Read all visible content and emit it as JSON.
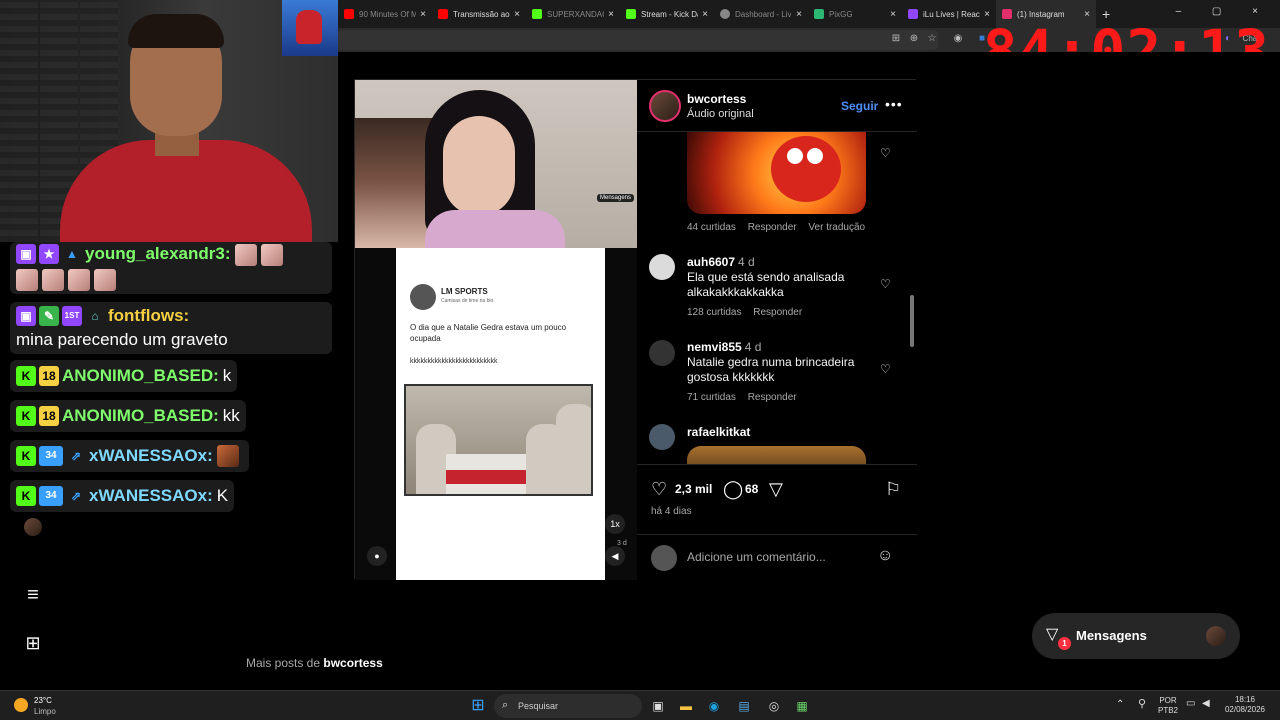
{
  "browser": {
    "tabs": [
      {
        "label": "90 Minutes Of M",
        "icon_color": "#ff0000",
        "active": false
      },
      {
        "label": "Transmissão ao vi",
        "icon_color": "#ff0000",
        "active": false
      },
      {
        "label": "SUPERXANDAO",
        "icon_color": "#53fc18",
        "active": false
      },
      {
        "label": "Stream - Kick Da",
        "icon_color": "#53fc18",
        "active": false
      },
      {
        "label": "Dashboard - Liv",
        "icon_color": "#888888",
        "active": false
      },
      {
        "label": "PixGG",
        "icon_color": "#2bb673",
        "active": false
      },
      {
        "label": "iLu Lives | React",
        "icon_color": "#9146ff",
        "active": false
      },
      {
        "label": "(1) Instagram",
        "icon_color": "#e1306c",
        "active": true
      }
    ],
    "new_tab": "+",
    "chat_label": "Chat"
  },
  "overlay": {
    "timer": "84:02:13"
  },
  "stream_chat": {
    "messages": [
      {
        "user": "young_alexandr3:",
        "text": "",
        "color": "#7fff6b"
      },
      {
        "user": "fontflows:",
        "text": "mina parecendo um graveto",
        "color": "#f5d042"
      },
      {
        "user": "ANONIMO_BASED:",
        "text": "k",
        "color": "#7fff6b",
        "badge": "18"
      },
      {
        "user": "ANONIMO_BASED:",
        "text": "kk",
        "color": "#7fff6b",
        "badge": "18"
      },
      {
        "user": "xWANESSAOx:",
        "text": "",
        "color": "#7fd8ff",
        "badge": "34"
      },
      {
        "user": "xWANESSAOx:",
        "text": "K",
        "color": "#7fd8ff",
        "badge": "34"
      }
    ],
    "subscriber_badge": "1ST"
  },
  "video": {
    "lm_name": "LM SPORTS",
    "lm_sub": "Camisas de time na bio.",
    "lm_text": "O dia que a Natalie Gedra estava um pouco ocupada",
    "lm_kk": "kkkkkkkkkkkkkkkkkkkkkkkkk",
    "speed": "1x",
    "mensagens_tag": "Mensagens",
    "time_tag": "3 d"
  },
  "post": {
    "username": "bwcortess",
    "audio": "Áudio original",
    "follow_label": "Seguir",
    "more_label": "•••",
    "likes": "2,3 mil",
    "comments_count": "68",
    "age": "há 4 dias",
    "add_comment_placeholder": "Adicione um comentário..."
  },
  "comments": [
    {
      "user": "",
      "time": "",
      "text": "",
      "likes": "44 curtidas",
      "reply": "Responder",
      "translate": "Ver tradução"
    },
    {
      "user": "auh6607",
      "time": "4 d",
      "text": "Ela que está sendo analisada alkakakkkakkakka",
      "likes": "128 curtidas",
      "reply": "Responder"
    },
    {
      "user": "nemvi855",
      "time": "4 d",
      "text": "Natalie gedra numa brincadeira gostosa kkkkkkk",
      "likes": "71 curtidas",
      "reply": "Responder"
    },
    {
      "user": "rafaelkitkat",
      "time": "",
      "text": ""
    }
  ],
  "page": {
    "more_posts_prefix": "Mais posts de",
    "more_posts_user": "bwcortess",
    "messages_label": "Mensagens",
    "messages_badge": "1"
  },
  "taskbar": {
    "temp": "23°C",
    "weather": "Limpo",
    "search_placeholder": "Pesquisar",
    "lang": "POR",
    "layout": "PTB2",
    "time": "18:16",
    "date": "02/08/2026"
  },
  "icons": {
    "heart": "heart-icon",
    "comment": "comment-icon",
    "share": "share-icon",
    "save": "bookmark-icon",
    "emoji": "emoji-icon",
    "menu": "hamburger-icon",
    "apps": "apps-grid-icon"
  }
}
